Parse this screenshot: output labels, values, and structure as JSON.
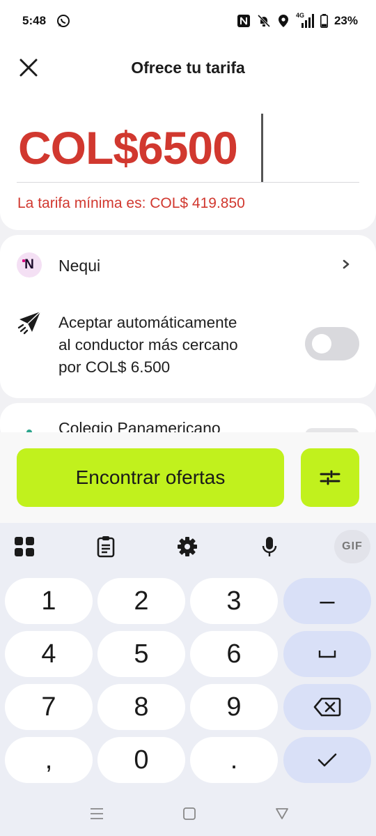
{
  "status_bar": {
    "time": "5:48",
    "network": "4G",
    "battery": "23%",
    "icons": [
      "whatsapp-icon",
      "nfc-icon",
      "bell-off-icon",
      "location-icon",
      "signal-icon",
      "battery-icon"
    ]
  },
  "header": {
    "title": "Ofrece tu tarifa",
    "close_icon": "close-icon"
  },
  "fare": {
    "value": "COL$6500",
    "warning": "La tarifa mínima es: COL$ 419.850",
    "color": "#d1382f"
  },
  "payment": {
    "label": "Nequi",
    "logo_letter": "N"
  },
  "auto_accept": {
    "line1": "Aceptar automáticamente",
    "line2": "al conductor más cercano",
    "line3": "por COL$ 6.500",
    "enabled": false
  },
  "destination": {
    "label": "Colegio Panamericano"
  },
  "actions": {
    "find_label": "Encontrar ofertas",
    "accent": "#c1f11d"
  },
  "keyboard": {
    "gif_label": "GIF",
    "keys": {
      "k1": "1",
      "k2": "2",
      "k3": "3",
      "minus": "–",
      "k4": "4",
      "k5": "5",
      "k6": "6",
      "space": "␣",
      "k7": "7",
      "k8": "8",
      "k9": "9",
      "comma": ",",
      "k0": "0",
      "period": "."
    }
  }
}
